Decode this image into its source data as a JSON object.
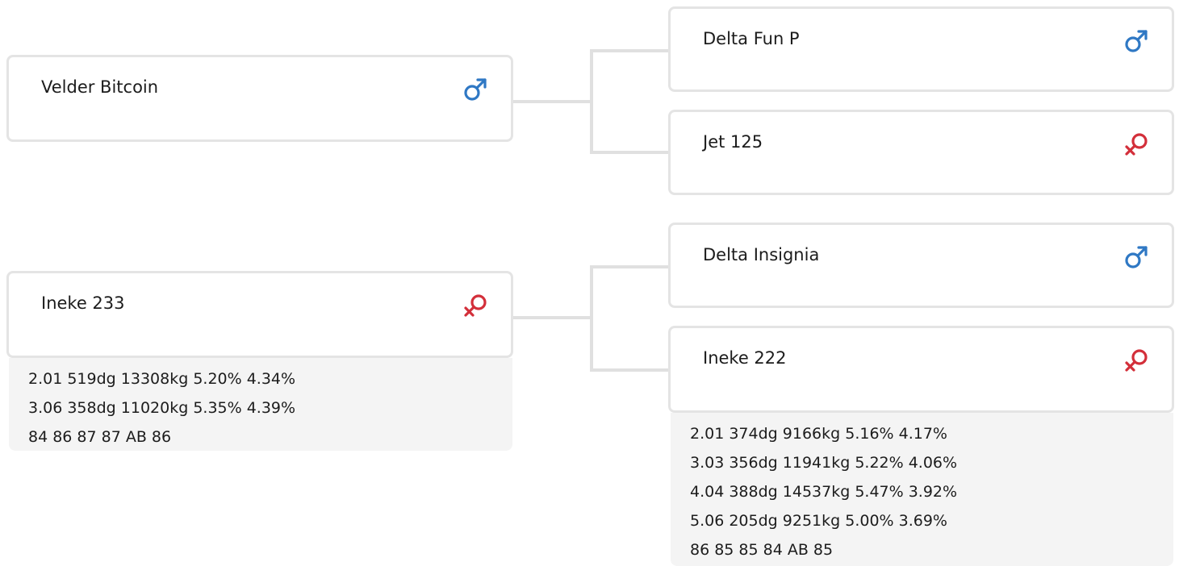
{
  "parents": [
    {
      "name": "Velder Bitcoin",
      "sex": "male",
      "stats": []
    },
    {
      "name": "Ineke 233",
      "sex": "female",
      "stats": [
        "2.01 519dg 13308kg 5.20% 4.34%",
        "3.06 358dg 11020kg 5.35% 4.39%",
        "84 86 87 87 AB 86"
      ]
    }
  ],
  "grandparents": [
    {
      "name": "Delta Fun P",
      "sex": "male",
      "stats": []
    },
    {
      "name": "Jet 125",
      "sex": "female",
      "stats": []
    },
    {
      "name": "Delta Insignia",
      "sex": "male",
      "stats": []
    },
    {
      "name": "Ineke 222",
      "sex": "female",
      "stats": [
        "2.01 374dg 9166kg 5.16% 4.17%",
        "3.03 356dg 11941kg 5.22% 4.06%",
        "4.04 388dg 14537kg 5.47% 3.92%",
        "5.06 205dg 9251kg 5.00% 3.69%",
        "86 85 85 84 AB 85"
      ]
    }
  ],
  "colors": {
    "male": "#2f78c4",
    "female": "#d32f3a",
    "card_border": "#e4e4e4",
    "connector": "#e0e0e0",
    "stats_background": "#f4f4f4"
  },
  "icons": {
    "male": "male-symbol-icon",
    "female": "female-symbol-icon"
  }
}
